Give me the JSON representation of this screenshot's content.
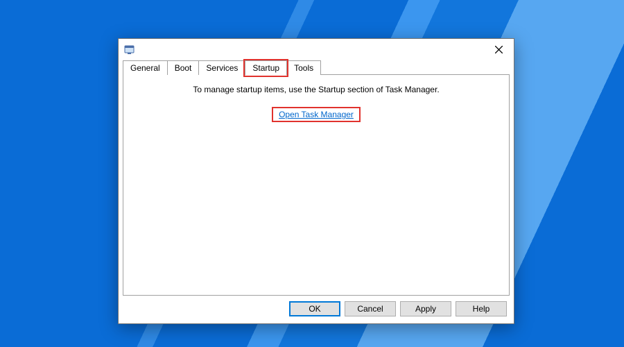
{
  "tabs": {
    "general": "General",
    "boot": "Boot",
    "services": "Services",
    "startup": "Startup",
    "tools": "Tools",
    "active": "startup"
  },
  "panel": {
    "hint": "To manage startup items, use the Startup section of Task Manager.",
    "link": "Open Task Manager"
  },
  "buttons": {
    "ok": "OK",
    "cancel": "Cancel",
    "apply": "Apply",
    "help": "Help"
  }
}
